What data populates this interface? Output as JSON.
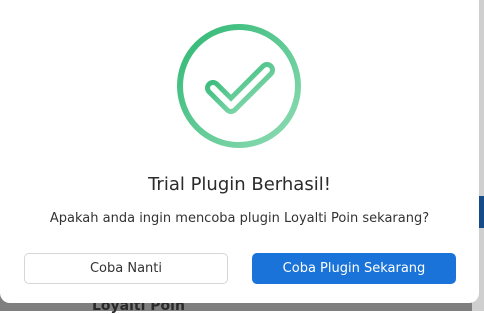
{
  "background": {
    "item_label": "Loyalti Poin"
  },
  "modal": {
    "title": "Trial Plugin Berhasil!",
    "message": "Apakah anda ingin mencoba plugin Loyalti Poin sekarang?",
    "icon": "check-circle-icon",
    "colors": {
      "success_green": "#3cc07e",
      "primary_blue": "#1a73d9"
    },
    "buttons": {
      "secondary_label": "Coba Nanti",
      "primary_label": "Coba Plugin Sekarang"
    }
  }
}
